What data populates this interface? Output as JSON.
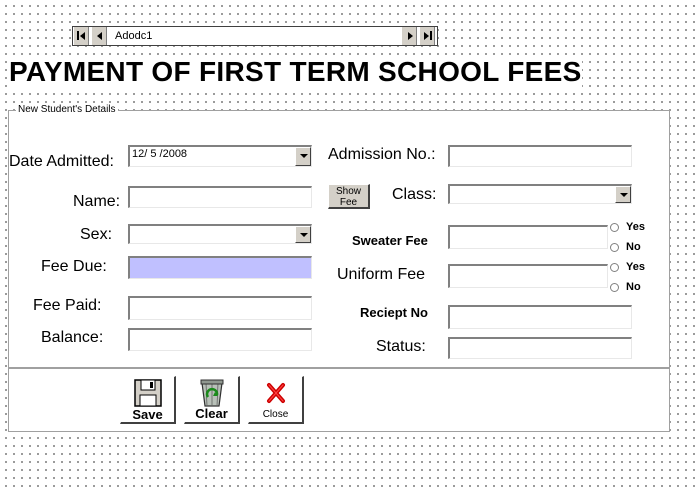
{
  "adodc": {
    "caption": "Adodc1"
  },
  "title": "PAYMENT OF FIRST  TERM SCHOOL FEES",
  "frame_title": "New Student's Details",
  "labels": {
    "date_admitted": "Date Admitted:",
    "name": "Name:",
    "sex": "Sex:",
    "fee_due": "Fee Due:",
    "fee_paid": "Fee Paid:",
    "balance": "Balance:",
    "admission_no": "Admission No.:",
    "class": "Class:",
    "sweater_fee": "Sweater Fee",
    "uniform_fee": "Uniform Fee",
    "reciept_no": "Reciept No",
    "status": "Status:"
  },
  "values": {
    "date_admitted": "12/ 5 /2008",
    "name": "",
    "sex": "",
    "fee_due": "",
    "fee_paid": "",
    "balance": "",
    "admission_no": "",
    "class": "",
    "sweater_fee": "",
    "uniform_fee": "",
    "reciept_no": "",
    "status": ""
  },
  "show_fee_line1": "Show",
  "show_fee_line2": "Fee",
  "radio": {
    "sweater_yes": "Yes",
    "sweater_no": "No",
    "uniform_yes": "Yes",
    "uniform_no": "No"
  },
  "buttons": {
    "save": "Save",
    "clear": "Clear",
    "close": "Close"
  },
  "colors": {
    "fee_due_highlight": "#c0c0ff",
    "control_face": "#d4d0c8"
  },
  "icons": [
    "first-record-icon",
    "prev-record-icon",
    "next-record-icon",
    "last-record-icon",
    "floppy-disk-icon",
    "recycle-bin-icon",
    "red-x-icon",
    "dropdown-arrow-icon"
  ]
}
